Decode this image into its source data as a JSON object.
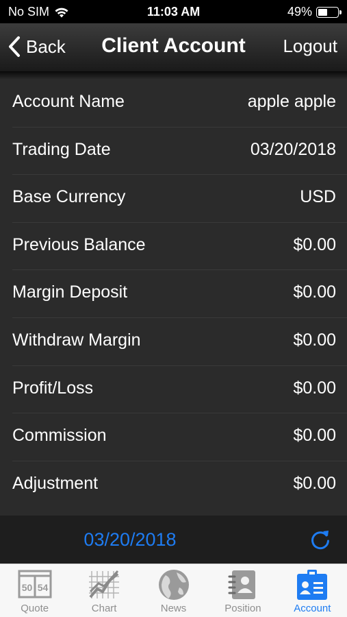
{
  "status_bar": {
    "carrier": "No SIM",
    "time": "11:03 AM",
    "battery": "49%",
    "battery_level": 0.49
  },
  "nav": {
    "back_label": "Back",
    "title": "Client Account",
    "logout_label": "Logout"
  },
  "rows": [
    {
      "label": "Account Name",
      "value": "apple apple"
    },
    {
      "label": "Trading Date",
      "value": "03/20/2018"
    },
    {
      "label": "Base Currency",
      "value": "USD"
    },
    {
      "label": "Previous Balance",
      "value": "$0.00"
    },
    {
      "label": "Margin Deposit",
      "value": "$0.00"
    },
    {
      "label": "Withdraw Margin",
      "value": "$0.00"
    },
    {
      "label": "Profit/Loss",
      "value": "$0.00"
    },
    {
      "label": "Commission",
      "value": "$0.00"
    },
    {
      "label": "Adjustment",
      "value": "$0.00"
    }
  ],
  "footer": {
    "date": "03/20/2018"
  },
  "tabs": [
    {
      "label": "Quote",
      "icon": "quote-icon",
      "icon_text_left": "50",
      "icon_text_right": "54"
    },
    {
      "label": "Chart",
      "icon": "chart-icon"
    },
    {
      "label": "News",
      "icon": "globe-icon"
    },
    {
      "label": "Position",
      "icon": "position-icon"
    },
    {
      "label": "Account",
      "icon": "account-icon",
      "active": true
    }
  ],
  "colors": {
    "accent": "#1e7cf2",
    "row_background": "#2b2b2b",
    "footer_background": "#1e1e1e",
    "tab_inactive": "#8e8e8e"
  }
}
